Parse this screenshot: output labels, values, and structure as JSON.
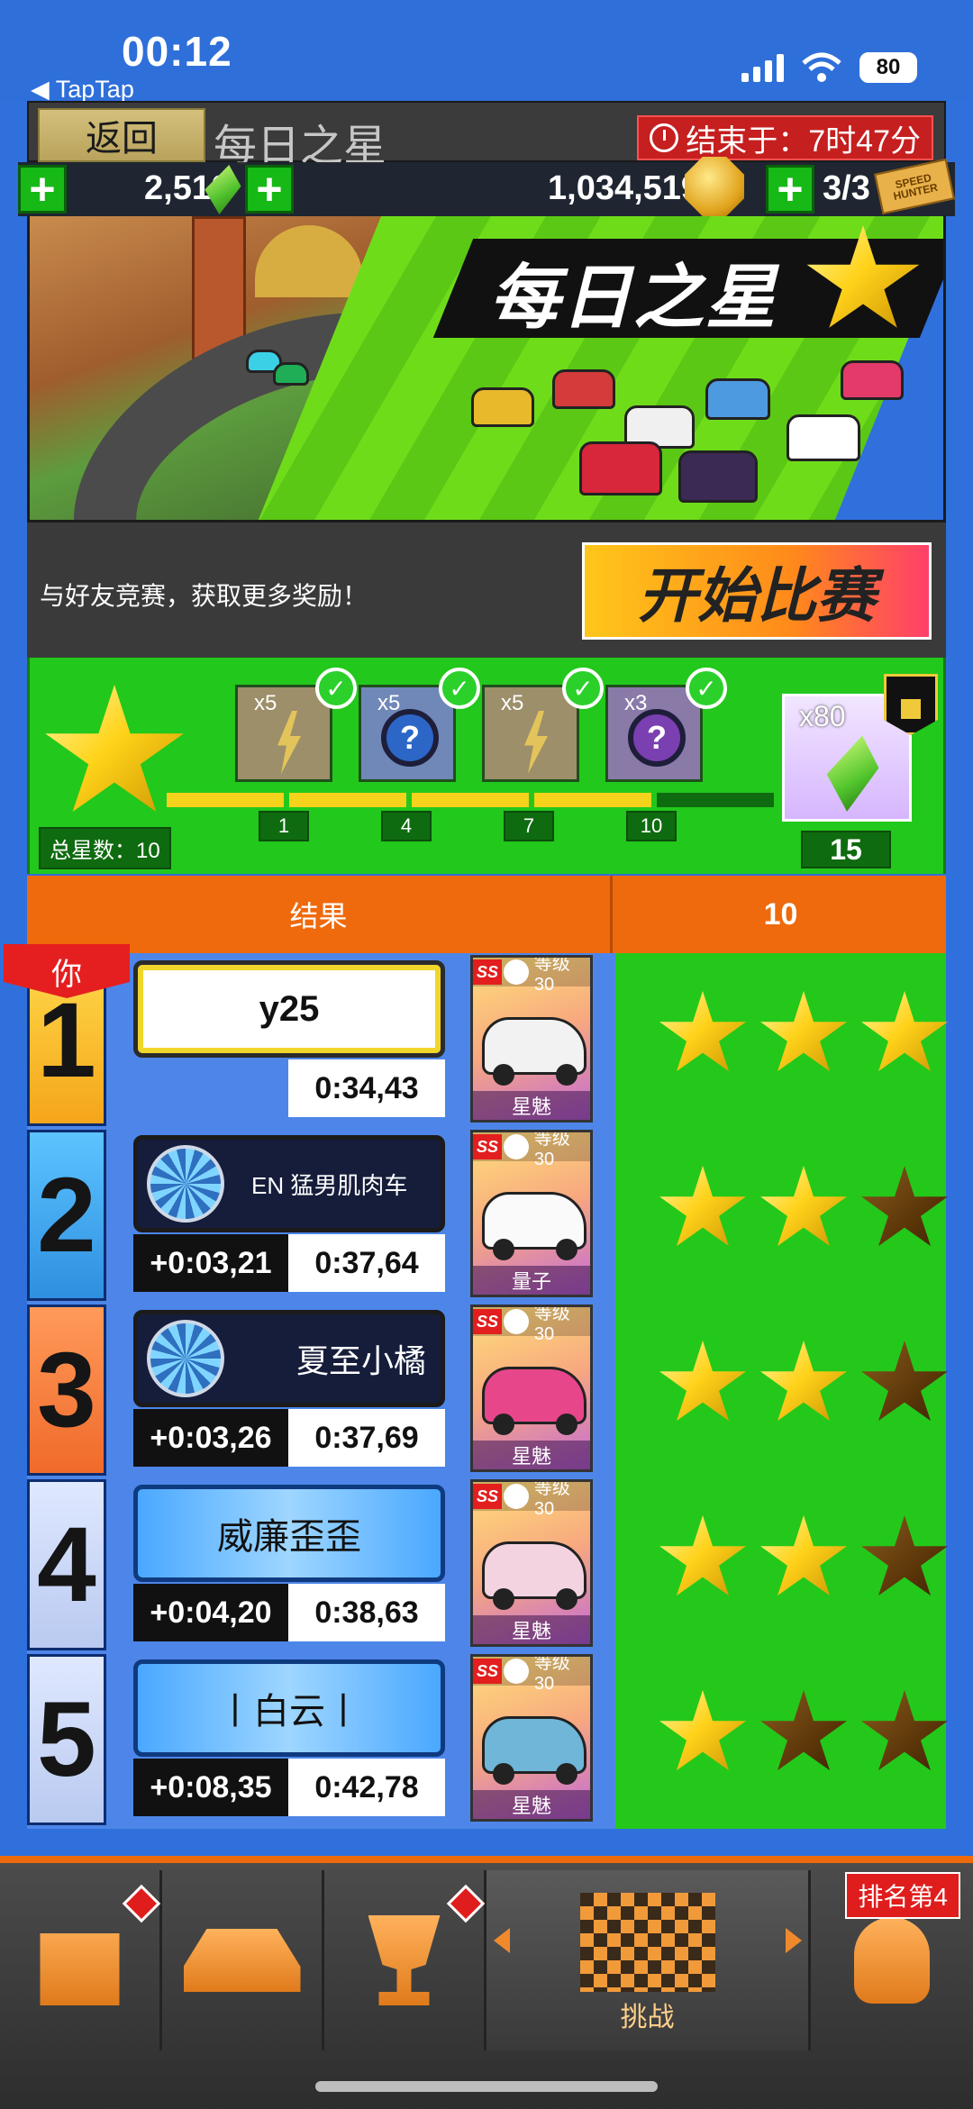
{
  "status_bar": {
    "time": "00:12",
    "back_app": "◀ TapTap",
    "battery": "80"
  },
  "header": {
    "back_label": "返回",
    "title": "每日之星",
    "end_timer": "结束于：7时47分"
  },
  "currency": {
    "gems": "2,510",
    "coins": "1,034,519",
    "tickets": "3/3",
    "ticket_text": "SPEED HUNTER"
  },
  "banner": {
    "title": "每日之星"
  },
  "invite": {
    "text": "与好友竞赛，获取更多奖励！",
    "start_label": "开始比赛"
  },
  "progress": {
    "total_stars_label": "总星数：10",
    "rewards": [
      {
        "qty": "x5",
        "type": "bolt",
        "claimed": true,
        "threshold": "1"
      },
      {
        "qty": "x5",
        "type": "mystery-blue",
        "claimed": true,
        "threshold": "4"
      },
      {
        "qty": "x5",
        "type": "bolt",
        "claimed": true,
        "threshold": "7"
      },
      {
        "qty": "x3",
        "type": "mystery-purple",
        "claimed": true,
        "threshold": "10"
      }
    ],
    "final_reward": {
      "qty": "x80",
      "threshold": "15",
      "locked": true
    }
  },
  "results": {
    "header_left": "结果",
    "header_right": "10",
    "you_label": "你",
    "rows": [
      {
        "rank": "1",
        "name": "y25",
        "plate": "welcome",
        "diff": "",
        "time": "0:34,43",
        "car_level": "等级30",
        "car_name": "星魅",
        "stars": 3
      },
      {
        "rank": "2",
        "name": "EN 猛男肌肉车",
        "plate": "dial",
        "diff": "+0:03,21",
        "time": "0:37,64",
        "car_level": "等级30",
        "car_name": "量子",
        "stars": 2
      },
      {
        "rank": "3",
        "name": "夏至小橘",
        "plate": "dial",
        "diff": "+0:03,26",
        "time": "0:37,69",
        "car_level": "等级30",
        "car_name": "星魅",
        "stars": 2
      },
      {
        "rank": "4",
        "name": "威廉歪歪",
        "plate": "flag",
        "diff": "+0:04,20",
        "time": "0:38,63",
        "car_level": "等级30",
        "car_name": "星魅",
        "stars": 2
      },
      {
        "rank": "5",
        "name": "丨白云丨",
        "plate": "flag",
        "diff": "+0:08,35",
        "time": "0:42,78",
        "car_level": "等级30",
        "car_name": "星魅",
        "stars": 1
      }
    ]
  },
  "bottom_nav": {
    "challenge_label": "挑战",
    "rank_badge": "排名第4"
  },
  "colors": {
    "background_blue": "#2f70dc",
    "accent_orange": "#ef6a0c",
    "green": "#24c81b",
    "star_gold": "#ffd21a"
  }
}
